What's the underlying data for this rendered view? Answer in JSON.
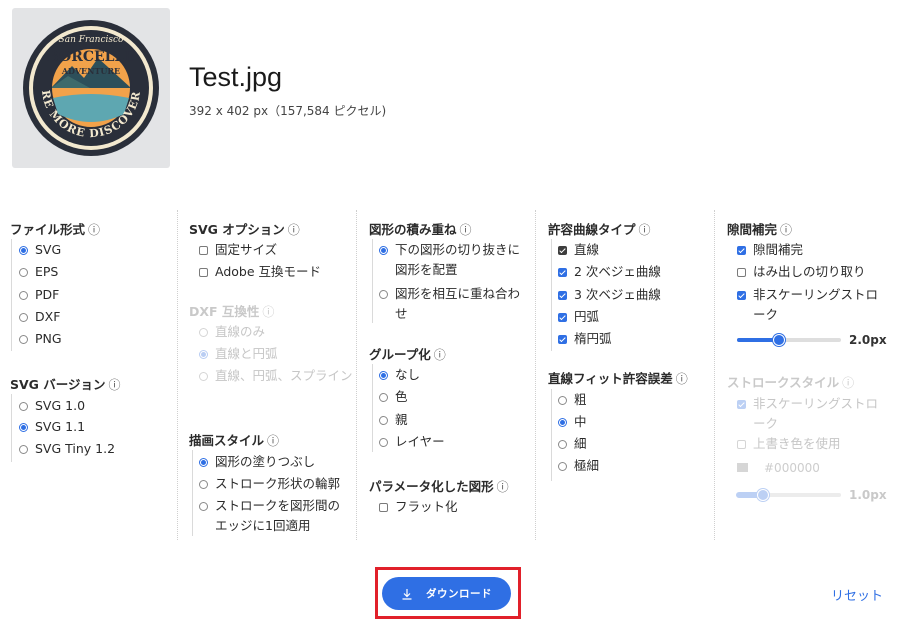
{
  "file": {
    "badge_top": "San Francisco",
    "badge_name": "BORCELLE",
    "badge_sub": "ADVENTURE",
    "badge_ring": "EXPLORE MORE DISCOVER MORE",
    "name": "Test.jpg",
    "meta": "392 x 402 px（157,584 ピクセル)"
  },
  "info_glyph": "ⓘ",
  "file_format": {
    "title": "ファイル形式",
    "options": [
      "SVG",
      "EPS",
      "PDF",
      "DXF",
      "PNG"
    ],
    "selected": "SVG"
  },
  "svg_version": {
    "title": "SVG バージョン",
    "options": [
      "SVG 1.0",
      "SVG 1.1",
      "SVG Tiny 1.2"
    ],
    "selected": "SVG 1.1"
  },
  "svg_options": {
    "title": "SVG オプション",
    "options": [
      "固定サイズ",
      "Adobe 互換モード"
    ]
  },
  "dxf_compat": {
    "title": "DXF 互換性",
    "disabled": true,
    "options": [
      "直線のみ",
      "直線と円弧",
      "直線、円弧、スプライン"
    ],
    "selected": "直線と円弧"
  },
  "draw_style": {
    "title": "描画スタイル",
    "options": [
      "図形の塗りつぶし",
      "ストローク形状の輪郭",
      "ストロークを図形間のエッジに1回適用"
    ],
    "selected": "図形の塗りつぶし"
  },
  "stacking": {
    "title": "図形の積み重ね",
    "options": [
      "下の図形の切り抜きに図形を配置",
      "図形を相互に重ね合わせ"
    ],
    "selected": "下の図形の切り抜きに図形を配置"
  },
  "grouping": {
    "title": "グループ化",
    "options": [
      "なし",
      "色",
      "親",
      "レイヤー"
    ],
    "selected": "なし"
  },
  "param_shapes": {
    "title": "パラメータ化した図形",
    "options": [
      "フラット化"
    ]
  },
  "curve_types": {
    "title": "許容曲線タイプ",
    "options": [
      "直線",
      "2 次ベジェ曲線",
      "3 次ベジェ曲線",
      "円弧",
      "楕円弧"
    ]
  },
  "line_fit": {
    "title": "直線フィット許容誤差",
    "options": [
      "粗",
      "中",
      "細",
      "極細"
    ],
    "selected": "中"
  },
  "gap_fill": {
    "title": "隙間補完",
    "options": [
      "隙間補完",
      "はみ出しの切り取り",
      "非スケーリングストローク"
    ],
    "checked": [
      "隙間補完",
      "非スケーリングストローク"
    ],
    "slider_value": "2.0px",
    "slider_fraction": 0.4
  },
  "stroke_style": {
    "title": "ストロークスタイル",
    "disabled": true,
    "options": [
      "非スケーリングストローク",
      "上書き色を使用"
    ],
    "checked": [
      "非スケーリングストローク"
    ],
    "color_hex": "#000000",
    "slider_value": "1.0px",
    "slider_fraction": 0.25
  },
  "actions": {
    "download": "ダウンロード",
    "reset": "リセット"
  },
  "colors": {
    "accent": "#2f6fe4",
    "highlight": "#e1202a"
  }
}
